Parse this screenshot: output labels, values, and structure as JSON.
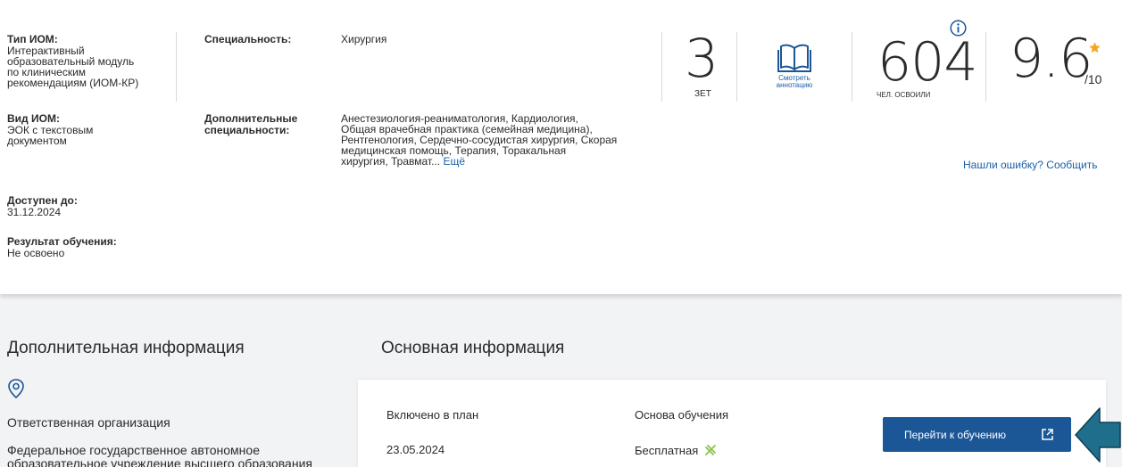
{
  "left_info": {
    "type_label": "Тип ИОМ:",
    "type_value_lines": [
      "Интерактивный",
      "образовательный модуль",
      "по клиническим",
      "рекомендациям (ИОМ-КР)"
    ],
    "kind_label": "Вид ИОМ:",
    "kind_value_lines": [
      "ЭОК с текстовым",
      "документом"
    ],
    "available_label": "Доступен до:",
    "available_value": "31.12.2024",
    "result_label": "Результат обучения:",
    "result_value": "Не освоено"
  },
  "specialty": {
    "label": "Специальность:",
    "value": "Хирургия",
    "extra_label_lines": [
      "Дополнительные",
      "специальности:"
    ],
    "extra_value_lines": [
      "Анестезиология-реаниматология, Кардиология,",
      "Общая врачебная практика (семейная медицина),",
      "Рентгенология, Сердечно-сосудистая хирургия, Скорая",
      "медицинская помощь, Терапия, Торакальная",
      "хирургия, Травмат..."
    ],
    "more_link": "Ещё"
  },
  "stats": {
    "zet_value": "3",
    "zet_label": "ЗЕТ",
    "annotation_line1": "Смотреть",
    "annotation_line2": "аннотацию",
    "learners_value": "604",
    "learners_label": "ЧЕЛ. ОСВОИЛИ",
    "rating_value": "9.6",
    "rating_max": "/10"
  },
  "report_error_link": "Нашли ошибку? Сообщить",
  "additional": {
    "heading": "Дополнительная информация",
    "org_title": "Ответственная организация",
    "org_lines": [
      "Федеральное государственное автономное",
      "образовательное учреждение высшего образования"
    ]
  },
  "main_info": {
    "heading": "Основная информация",
    "included_label": "Включено в план",
    "included_value": "23.05.2024",
    "basis_label": "Основа обучения",
    "basis_value": "Бесплатная",
    "go_button": "Перейти к обучению"
  },
  "colors": {
    "accent_blue": "#1b5797",
    "link_blue": "#1a5fa8",
    "star_orange": "#f5a623",
    "arrow_teal": "#1f6e8c",
    "free_green": "#8bc34a"
  }
}
